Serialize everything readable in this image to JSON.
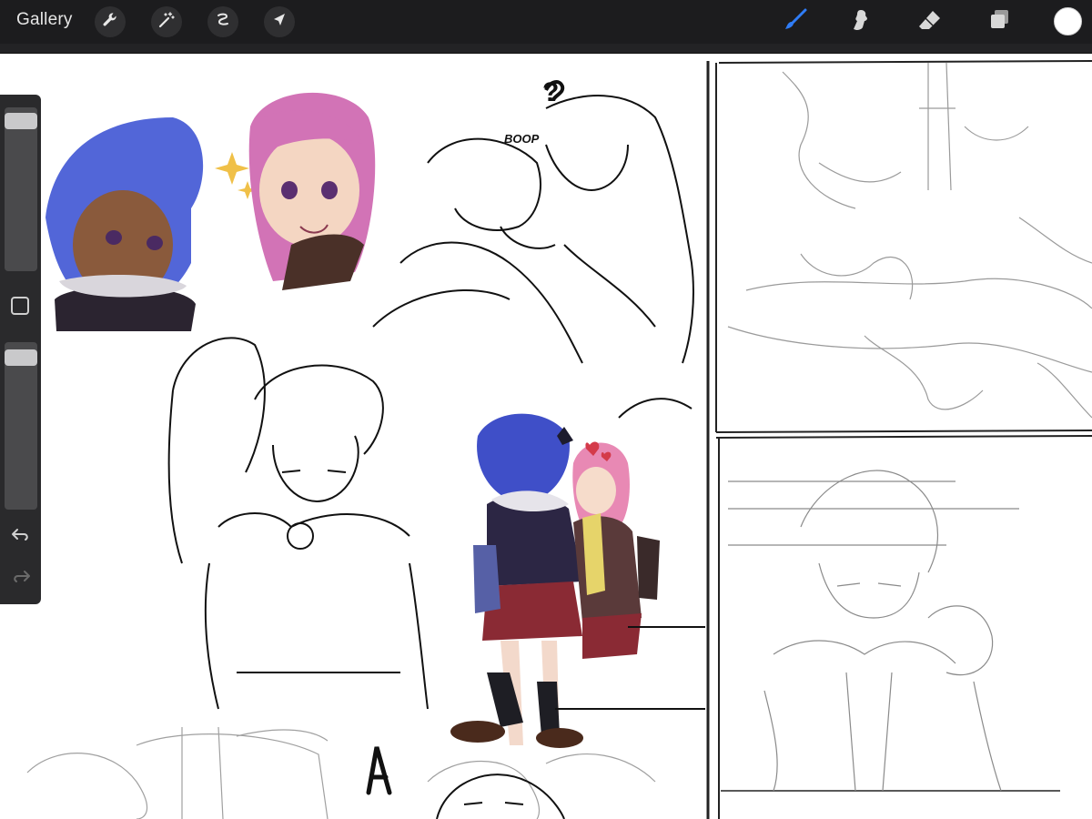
{
  "toolbar": {
    "gallery_label": "Gallery",
    "left_tools": [
      {
        "icon": "wrench-icon",
        "name": "actions"
      },
      {
        "icon": "magic-wand-icon",
        "name": "adjustments"
      },
      {
        "icon": "selection-icon",
        "name": "selection"
      },
      {
        "icon": "arrow-cursor-icon",
        "name": "transform"
      }
    ],
    "right_tools": [
      {
        "icon": "brush-icon",
        "name": "paint",
        "active": true,
        "color": "#2f7cf6"
      },
      {
        "icon": "smudge-icon",
        "name": "smudge",
        "active": false
      },
      {
        "icon": "eraser-icon",
        "name": "erase",
        "active": false
      },
      {
        "icon": "layers-icon",
        "name": "layers",
        "active": false
      }
    ],
    "current_color": "#ffffff"
  },
  "sidebar": {
    "brush_size": 0.04,
    "opacity": 0.05
  },
  "canvas": {
    "annotations": [
      "?",
      "BOOP",
      "A"
    ]
  },
  "colors": {
    "toolbar_bg": "#1c1c1e",
    "sidebar_bg": "#2a2a2c",
    "active_tool": "#2f7cf6",
    "canvas_bg": "#ffffff"
  }
}
